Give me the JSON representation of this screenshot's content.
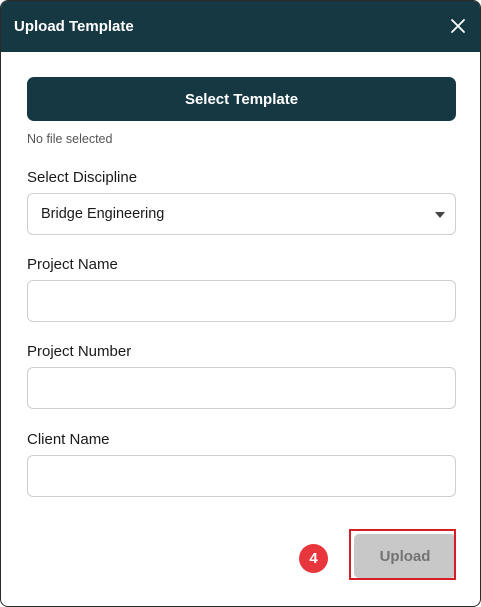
{
  "dialog": {
    "title": "Upload Template",
    "close_icon": "close-icon"
  },
  "template": {
    "select_label": "Select Template",
    "file_status": "No file selected"
  },
  "discipline": {
    "label": "Select Discipline",
    "selected": "Bridge Engineering"
  },
  "project_name": {
    "label": "Project Name",
    "value": ""
  },
  "project_number": {
    "label": "Project Number",
    "value": ""
  },
  "client_name": {
    "label": "Client Name",
    "value": ""
  },
  "annotation": {
    "step": "4"
  },
  "footer": {
    "upload_label": "Upload"
  },
  "colors": {
    "header_bg": "#163843",
    "primary_button": "#163843",
    "disabled_button": "#c8c8c8",
    "annotation_red": "#e8373c"
  }
}
